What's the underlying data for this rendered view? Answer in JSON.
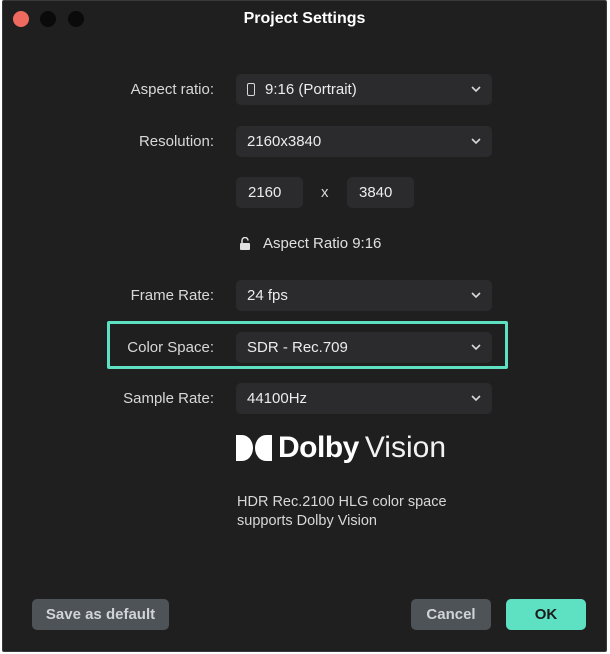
{
  "window": {
    "title": "Project Settings"
  },
  "aspect_ratio": {
    "label": "Aspect ratio:",
    "value": "9:16 (Portrait)"
  },
  "resolution": {
    "label": "Resolution:",
    "value": "2160x3840",
    "width": "2160",
    "height": "3840",
    "separator": "x",
    "lock_text": "Aspect Ratio 9:16"
  },
  "frame_rate": {
    "label": "Frame Rate:",
    "value": "24 fps"
  },
  "color_space": {
    "label": "Color Space:",
    "value": "SDR - Rec.709",
    "highlight_color": "#5ee0c2"
  },
  "sample_rate": {
    "label": "Sample Rate:",
    "value": "44100Hz"
  },
  "dolby": {
    "brand": "Dolby",
    "product": "Vision",
    "note": "HDR Rec.2100 HLG color space supports Dolby Vision"
  },
  "buttons": {
    "save_default": "Save as default",
    "cancel": "Cancel",
    "ok": "OK"
  },
  "colors": {
    "accent": "#5ee0c2",
    "background": "#1f1f20",
    "field": "#2b2b2d",
    "close": "#ee6a5f"
  },
  "icons": {
    "aspect": "phone-portrait-icon",
    "lock": "unlock-icon",
    "dropdown": "chevron-down-icon"
  }
}
